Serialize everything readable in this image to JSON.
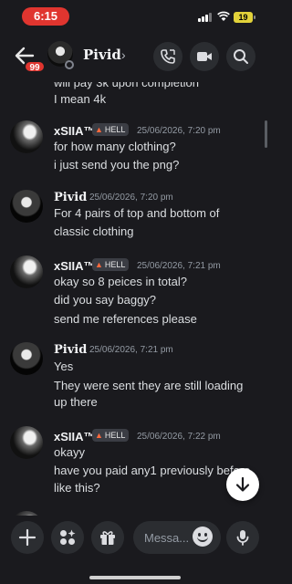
{
  "status_bar": {
    "time": "6:15",
    "battery": "19"
  },
  "header": {
    "unread_count": "99",
    "contact_name": "Pivid",
    "chevron": "›"
  },
  "messages": {
    "partial_line": "will pay 3k upon completion",
    "line_4k": "I mean 4k",
    "groups": [
      {
        "author": "xSIIA™",
        "tag": "HELL",
        "timestamp": "25/06/2026, 7:20 pm",
        "lines": [
          "for how many clothing?",
          "i just send you the png?"
        ]
      },
      {
        "author": "Pivid",
        "timestamp": "25/06/2026, 7:20 pm",
        "lines": [
          "For 4 pairs of top and bottom of",
          "classic clothing"
        ]
      },
      {
        "author": "xSIIA™",
        "tag": "HELL",
        "timestamp": "25/06/2026, 7:21 pm",
        "lines": [
          "okay so 8 peices in total?",
          "did you say baggy?",
          "send me references please"
        ]
      },
      {
        "author": "Pivid",
        "timestamp": "25/06/2026, 7:21 pm",
        "lines": [
          "Yes",
          "They were sent they are still loading",
          "up there"
        ]
      },
      {
        "author": "xSIIA™",
        "tag": "HELL",
        "timestamp": "25/06/2026, 7:22 pm",
        "lines": [
          "okayy",
          "have you paid any1 previously before",
          "like this?"
        ]
      }
    ]
  },
  "composer": {
    "placeholder": "Messa..."
  },
  "icons": {
    "back": "arrow-left-icon",
    "call": "phone-icon",
    "video": "video-camera-icon",
    "search": "search-icon",
    "plus": "plus-icon",
    "apps": "apps-icon",
    "gift": "gift-icon",
    "emoji": "emoji-icon",
    "mic": "microphone-icon",
    "jump": "arrow-down-icon"
  },
  "colors": {
    "accent_red": "#e0352f",
    "background": "#1a1a1e",
    "button_bg": "#2b2d31"
  }
}
